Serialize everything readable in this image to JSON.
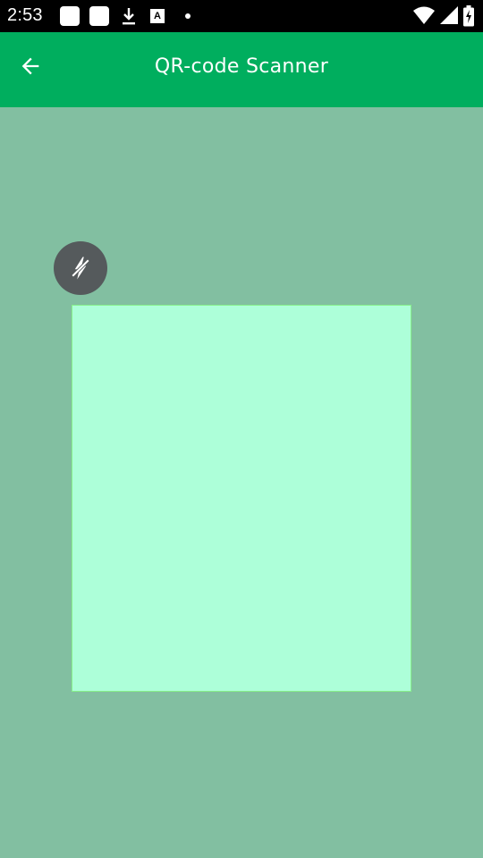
{
  "status_bar": {
    "time": "2:53",
    "notification_icons": [
      "app-icon",
      "app-icon",
      "download-icon",
      "font-a-icon",
      "dot-icon"
    ],
    "system_icons": [
      "wifi-icon",
      "signal-icon",
      "battery-charging-icon"
    ]
  },
  "app_bar": {
    "title": "QR-code Scanner",
    "back_icon": "arrow-back-icon",
    "background_color": "#00ae5e"
  },
  "scanner": {
    "flash_icon": "flash-off-icon",
    "camera_preview_color": "#82bfa1",
    "frame_fill_color": "#adffd9",
    "frame_border_color": "#86f08a"
  }
}
